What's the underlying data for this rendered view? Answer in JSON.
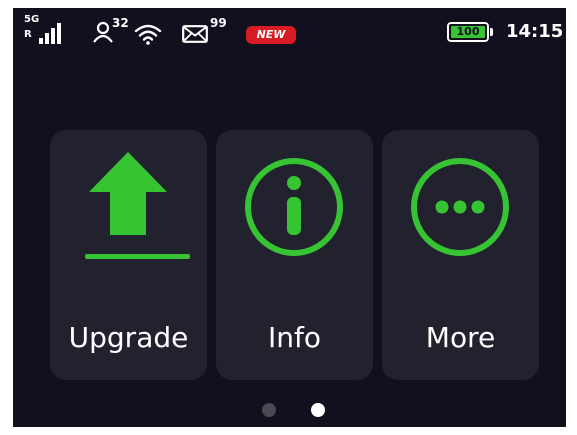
{
  "status_bar": {
    "network_type": "5G",
    "roaming": "R",
    "connected_users": "32",
    "unread_messages": "99",
    "new_badge": "NEW",
    "battery_level": "100",
    "time": "14:15"
  },
  "menu": {
    "tiles": [
      {
        "label": "Upgrade",
        "icon": "upload-icon"
      },
      {
        "label": "Info",
        "icon": "info-icon"
      },
      {
        "label": "More",
        "icon": "more-icon"
      }
    ],
    "page_count": 2,
    "current_page": 2
  },
  "colors": {
    "background": "#10101e",
    "tile": "#22222f",
    "accent_green": "#37c433",
    "badge_red": "#d91c24"
  }
}
